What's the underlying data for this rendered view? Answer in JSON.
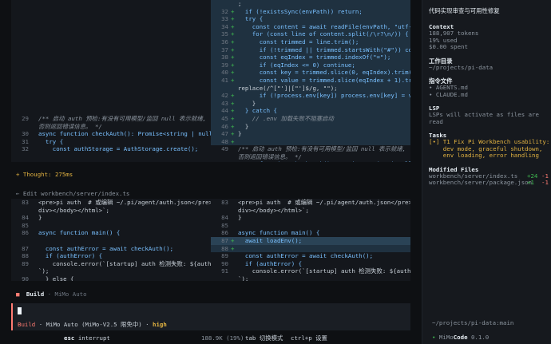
{
  "diff_top": {
    "left": [
      {
        "ln": "",
        "mk": "",
        "code": ""
      },
      {
        "ln": "",
        "mk": "",
        "code": ""
      },
      {
        "ln": "",
        "mk": "",
        "code": ""
      },
      {
        "ln": "",
        "mk": "",
        "code": ""
      },
      {
        "ln": "",
        "mk": "",
        "code": ""
      },
      {
        "ln": "",
        "mk": "",
        "code": ""
      },
      {
        "ln": "",
        "mk": "",
        "code": ""
      },
      {
        "ln": "",
        "mk": "",
        "code": ""
      },
      {
        "ln": "",
        "mk": "",
        "code": ""
      },
      {
        "ln": "",
        "mk": "",
        "code": ""
      },
      {
        "ln": "",
        "mk": "",
        "code": ""
      },
      {
        "ln": "",
        "mk": "",
        "code": ""
      },
      {
        "ln": "",
        "mk": "",
        "code": ""
      },
      {
        "ln": "",
        "mk": "",
        "code": ""
      },
      {
        "ln": "",
        "mk": "",
        "code": ""
      },
      {
        "ln": "29",
        "mk": "",
        "code": "/** 启动 auth 预检:有没有可用模型/监回 null 表示就绪,"
      },
      {
        "ln": "",
        "mk": "",
        "code": "否则返回错误信息。 */"
      },
      {
        "ln": "30",
        "mk": "",
        "code": "async function checkAuth(): Promise<string | null> {"
      },
      {
        "ln": "31",
        "mk": "",
        "code": "  try {"
      },
      {
        "ln": "32",
        "mk": "",
        "code": "    const authStorage = AuthStorage.create();"
      }
    ],
    "right": [
      {
        "ln": "",
        "mk": "",
        "code": ";",
        "hl": "add"
      },
      {
        "ln": "32",
        "mk": "+",
        "code": "  if (!existsSync(envPath)) return;",
        "hl": "add"
      },
      {
        "ln": "33",
        "mk": "+",
        "code": "  try {",
        "hl": "add"
      },
      {
        "ln": "34",
        "mk": "+",
        "code": "    const content = await readFile(envPath, \"utf-8\");",
        "hl": "add"
      },
      {
        "ln": "35",
        "mk": "+",
        "code": "    for (const line of content.split(/\\r?\\n/)) {",
        "hl": "add"
      },
      {
        "ln": "36",
        "mk": "+",
        "code": "      const trimmed = line.trim();",
        "hl": "add"
      },
      {
        "ln": "37",
        "mk": "+",
        "code": "      if (!trimmed || trimmed.startsWith(\"#\")) continue",
        "hl": "add"
      },
      {
        "ln": "38",
        "mk": "+",
        "code": "      const eqIndex = trimmed.indexOf(\"=\");",
        "hl": "add"
      },
      {
        "ln": "39",
        "mk": "+",
        "code": "      if (eqIndex <= 0) continue;",
        "hl": "add"
      },
      {
        "ln": "40",
        "mk": "+",
        "code": "      const key = trimmed.slice(0, eqIndex).trim();",
        "hl": "add"
      },
      {
        "ln": "41",
        "mk": "+",
        "code": "      const value = trimmed.slice(eqIndex + 1).trim().",
        "hl": "add"
      },
      {
        "ln": "",
        "mk": "",
        "code": "replace(/^[\"']|[\"']$/g, \"\");",
        "hl": "add"
      },
      {
        "ln": "42",
        "mk": "+",
        "code": "      if (!process.env[key]) process.env[key] = value;",
        "hl": "add"
      },
      {
        "ln": "43",
        "mk": "+",
        "code": "    }",
        "hl": "add"
      },
      {
        "ln": "44",
        "mk": "+",
        "code": "  } catch {",
        "hl": "add"
      },
      {
        "ln": "45",
        "mk": "+",
        "code": "    // .env 加载失败不阻塞启动",
        "hl": "add"
      },
      {
        "ln": "46",
        "mk": "+",
        "code": "  }",
        "hl": "add"
      },
      {
        "ln": "47",
        "mk": "+",
        "code": "}",
        "hl": "add"
      },
      {
        "ln": "48",
        "mk": "+",
        "code": "",
        "hl": "add"
      },
      {
        "ln": "49",
        "mk": "",
        "code": "/** 启动 auth 预检:有没有可用模型/监回 null 表示就绪,",
        "hl": ""
      },
      {
        "ln": "",
        "mk": "",
        "code": "否则返回错误信息。 */",
        "hl": ""
      },
      {
        "ln": "50",
        "mk": "",
        "code": "async function checkAuth(): Promise<string | null> {",
        "hl": ""
      },
      {
        "ln": "51",
        "mk": "",
        "code": "  try {",
        "hl": ""
      },
      {
        "ln": "52",
        "mk": "",
        "code": "    const authStorage = AuthStorage.create();",
        "hl": ""
      }
    ]
  },
  "thought": "+ Thought: 275ms",
  "edit_label": "← Edit workbench/server/index.ts",
  "diff_bottom": {
    "left": [
      {
        "ln": "83",
        "mk": "",
        "code": "<pre>pi auth  # 或编辑 ~/.pi/agent/auth.json</pre></"
      },
      {
        "ln": "",
        "mk": "",
        "code": "div></body></html>`;"
      },
      {
        "ln": "84",
        "mk": "",
        "code": "}"
      },
      {
        "ln": "85",
        "mk": "",
        "code": ""
      },
      {
        "ln": "86",
        "mk": "",
        "code": "async function main() {"
      },
      {
        "ln": "",
        "mk": "",
        "code": ""
      },
      {
        "ln": "87",
        "mk": "",
        "code": "  const authError = await checkAuth();"
      },
      {
        "ln": "88",
        "mk": "",
        "code": "  if (authError) {"
      },
      {
        "ln": "89",
        "mk": "",
        "code": "    console.error(`[startup] auth 检测失败: ${authError}"
      },
      {
        "ln": "",
        "mk": "",
        "code": "`);"
      },
      {
        "ln": "90",
        "mk": "",
        "code": "  } else {"
      }
    ],
    "right": [
      {
        "ln": "83",
        "mk": "",
        "code": "<pre>pi auth  # 或编辑 ~/.pi/agent/auth.json</pre></",
        "hl": ""
      },
      {
        "ln": "",
        "mk": "",
        "code": "div></body></html>`;",
        "hl": ""
      },
      {
        "ln": "84",
        "mk": "",
        "code": "}",
        "hl": ""
      },
      {
        "ln": "85",
        "mk": "",
        "code": "",
        "hl": ""
      },
      {
        "ln": "86",
        "mk": "",
        "code": "async function main() {",
        "hl": ""
      },
      {
        "ln": "87",
        "mk": "+",
        "code": "  await loadEnv();",
        "hl": "addbright"
      },
      {
        "ln": "88",
        "mk": "+",
        "code": "",
        "hl": "add"
      },
      {
        "ln": "89",
        "mk": "",
        "code": "  const authError = await checkAuth();",
        "hl": ""
      },
      {
        "ln": "90",
        "mk": "",
        "code": "  if (authError) {",
        "hl": ""
      },
      {
        "ln": "91",
        "mk": "",
        "code": "    console.error(`[startup] auth 检测失败: ${authError}",
        "hl": ""
      },
      {
        "ln": "",
        "mk": "",
        "code": "`);",
        "hl": ""
      },
      {
        "ln": "92",
        "mk": "",
        "code": "  } else {",
        "hl": ""
      }
    ]
  },
  "build": {
    "marker": "■",
    "name": "Build",
    "sep": "·",
    "model": "MiMo Auto"
  },
  "input": {
    "agent": "Build",
    "sep1": "·",
    "model_full": "MiMo Auto (MiMo-V2.5 限免中)",
    "sep2": "·",
    "variant": "high"
  },
  "footer": {
    "esc_key": "esc",
    "esc_label": "interrupt",
    "tokens": "188.9K (19%)",
    "tab_hint": "tab 切换模式",
    "ctrl_hint": "ctrl+p 设置"
  },
  "sidebar": {
    "title": "代码实现审查与可用性修复",
    "context": {
      "heading": "Context",
      "tokens": "188,907 tokens",
      "used": "19% used",
      "spent": "$0.00 spent"
    },
    "workdir": {
      "heading": "工作目录",
      "path": "~/projects/pi-data"
    },
    "instructions": {
      "heading": "指令文件",
      "items": [
        "• AGENTS.md",
        "• CLAUDE.md"
      ]
    },
    "lsp": {
      "heading": "LSP",
      "text": "LSPs will activate as files are read"
    },
    "tasks": {
      "heading": "Tasks",
      "lines": [
        "[•] T1 Fix Pi Workbench usability:",
        "    dev mode, graceful shutdown,",
        "    env loading, error handling"
      ]
    },
    "modified": {
      "heading": "Modified Files",
      "files": [
        {
          "path": "workbench/server/index.ts",
          "add": "+24",
          "del": "-1"
        },
        {
          "path": "workbench/server/package.json",
          "add": "+1",
          "del": "-1"
        }
      ]
    },
    "bottom_path": "~/projects/pi-data:main",
    "brand": {
      "dot": "•",
      "name_a": "MiMo",
      "name_b": "Code",
      "version": "0.1.0"
    }
  },
  "colors": {
    "accent": "#ff7b72",
    "add_bg": "#1f3140",
    "plus": "#3fb950",
    "thought": "#e3b341"
  }
}
